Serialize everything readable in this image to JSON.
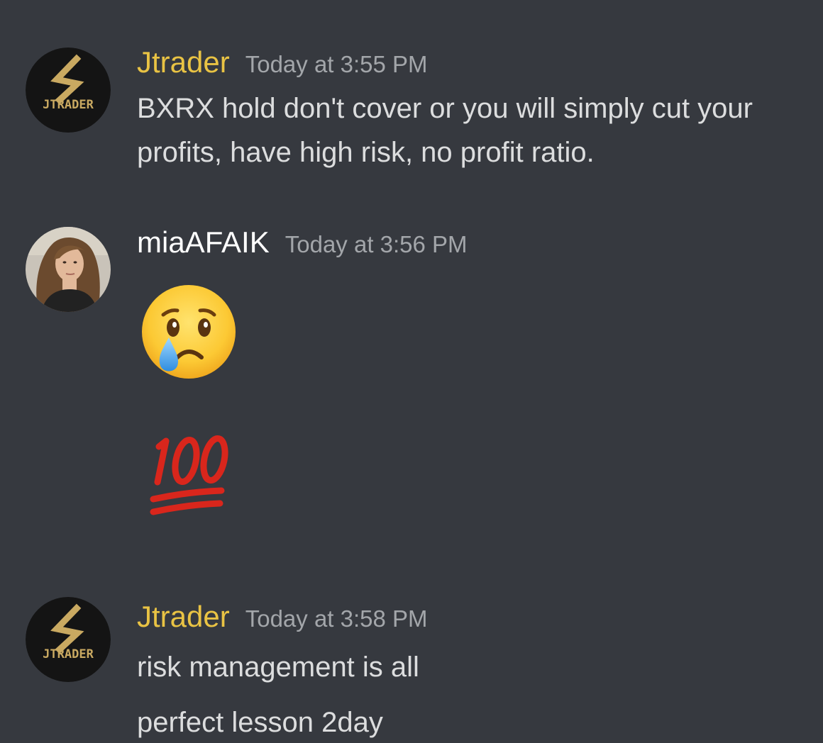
{
  "colors": {
    "background": "#36393f",
    "jtrader_name": "#e9c344",
    "username_default": "#ffffff",
    "timestamp": "#a3a6aa",
    "message_text": "#dcddde"
  },
  "messages": [
    {
      "author": "Jtrader",
      "timestamp": "Today at 3:55 PM",
      "avatar_label": "JTRADER",
      "avatar_icon": "lightning-s-logo",
      "lines": [
        "BXRX hold don't cover or you will simply cut your profits, have high risk, no profit ratio."
      ]
    },
    {
      "author": "miaAFAIK",
      "timestamp": "Today at 3:56 PM",
      "avatar_icon": "profile-photo",
      "emojis": [
        "crying-face-emoji",
        "hundred-points-emoji"
      ]
    },
    {
      "author": "Jtrader",
      "timestamp": "Today at 3:58 PM",
      "avatar_label": "JTRADER",
      "avatar_icon": "lightning-s-logo",
      "lines": [
        "risk management is all",
        "perfect lesson 2day"
      ]
    }
  ]
}
